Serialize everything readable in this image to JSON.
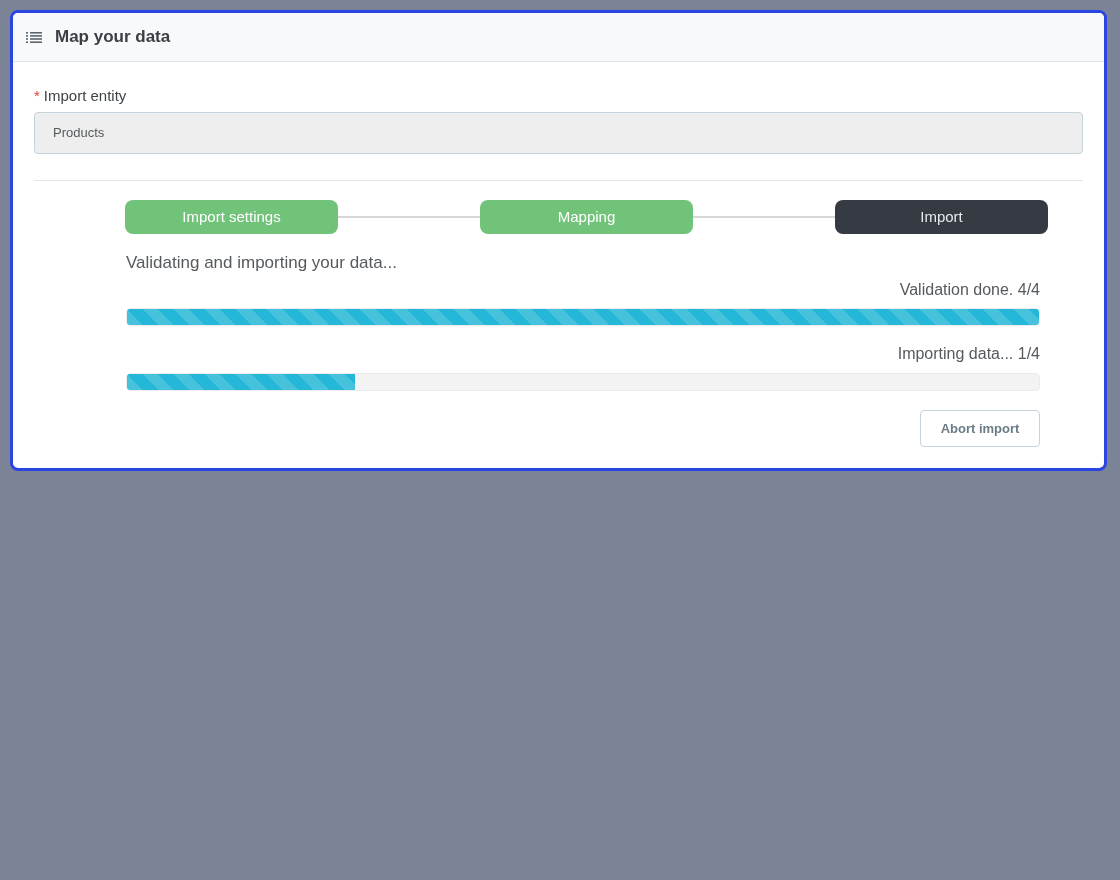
{
  "panel": {
    "title": "Map your data"
  },
  "import_entity": {
    "label": "Import entity",
    "required_mark": "*",
    "value": "Products",
    "disabled": true
  },
  "steps": [
    {
      "label": "Import settings",
      "completed": true,
      "selected": false
    },
    {
      "label": "Mapping",
      "completed": true,
      "selected": false
    },
    {
      "label": "Import",
      "completed": false,
      "selected": true
    }
  ],
  "status_message": "Validating and importing your data...",
  "progress": [
    {
      "label": "Validation done. 4/4",
      "level": 1
    },
    {
      "label": "Importing data... 1/4",
      "level": 0.25
    }
  ],
  "buttons": [
    {
      "label": "Abort import"
    }
  ]
}
